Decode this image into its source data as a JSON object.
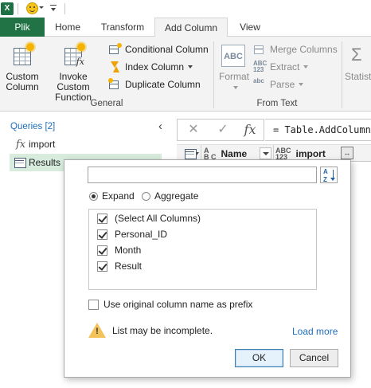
{
  "app": {
    "logo_text": "X"
  },
  "tabs": {
    "file": "Plik",
    "home": "Home",
    "transform": "Transform",
    "add_column": "Add Column",
    "view": "View"
  },
  "ribbon": {
    "custom_column": [
      "Custom",
      "Column"
    ],
    "invoke_custom_function": [
      "Invoke Custom",
      "Function"
    ],
    "conditional_column": "Conditional Column",
    "index_column": "Index Column",
    "duplicate_column": "Duplicate Column",
    "general_group": "General",
    "format": "Format",
    "merge_columns": "Merge Columns",
    "extract": "Extract",
    "parse": "Parse",
    "from_text_group": "From Text",
    "statistics": "Statisti",
    "abc_icon": [
      "ABC",
      "123"
    ],
    "abc_format_icon": "ABC",
    "parse_icon": "abc"
  },
  "queries": {
    "title": "Queries [2]",
    "items": [
      {
        "name": "import",
        "icon": "fx-icon"
      },
      {
        "name": "Results",
        "icon": "table-icon"
      }
    ]
  },
  "formula_bar": {
    "cancel_glyph": "✕",
    "commit_glyph": "✓",
    "fx_glyph": "fx",
    "formula": "= Table.AddColumn(a"
  },
  "grid": {
    "columns": [
      {
        "type": [
          "A",
          "B C"
        ],
        "name": "Name"
      },
      {
        "type": [
          "ABC",
          "123"
        ],
        "name": "import"
      }
    ]
  },
  "popup": {
    "search_placeholder": "",
    "expand_label": "Expand",
    "aggregate_label": "Aggregate",
    "mode": "Expand",
    "columns": [
      {
        "label": "(Select All Columns)",
        "checked": true
      },
      {
        "label": "Personal_ID",
        "checked": true
      },
      {
        "label": "Month",
        "checked": true
      },
      {
        "label": "Result",
        "checked": true
      }
    ],
    "prefix_label": "Use original column name as prefix",
    "prefix_checked": false,
    "warning": "List may be incomplete.",
    "load_more": "Load more",
    "ok": "OK",
    "cancel": "Cancel",
    "sort_icon": [
      "A",
      "Z"
    ]
  },
  "colors": {
    "file_tab": "#217346",
    "selected_query": "#d7ecdc",
    "link": "#1f6fbf",
    "warning": "#f3c25b"
  }
}
